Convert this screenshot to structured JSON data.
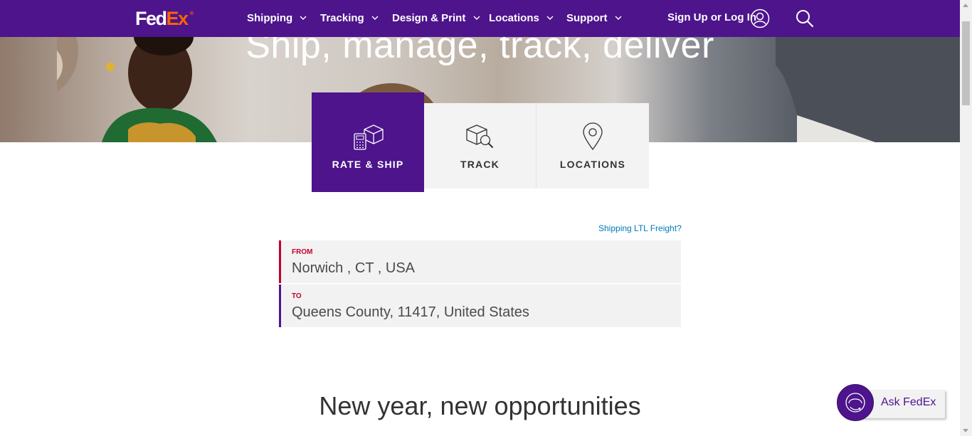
{
  "header": {
    "logo_fed": "Fed",
    "logo_ex": "Ex",
    "logo_mark": "®",
    "nav": [
      {
        "label": "Shipping"
      },
      {
        "label": "Tracking"
      },
      {
        "label": "Design & Print"
      },
      {
        "label": "Locations"
      },
      {
        "label": "Support"
      }
    ],
    "login_label": "Sign Up or Log In"
  },
  "hero": {
    "title": "Ship, manage, track, deliver"
  },
  "tabs": [
    {
      "label": "RATE & SHIP",
      "icon": "package-calculator-icon",
      "active": true
    },
    {
      "label": "TRACK",
      "icon": "package-search-icon",
      "active": false
    },
    {
      "label": "LOCATIONS",
      "icon": "map-pin-icon",
      "active": false
    }
  ],
  "rate_form": {
    "ltl_link": "Shipping LTL Freight?",
    "from_label": "FROM",
    "from_value": "Norwich , CT , USA",
    "to_label": "TO",
    "to_value": "Queens County, 11417, United States"
  },
  "promo": {
    "heading": "New year, new opportunities"
  },
  "chat": {
    "label": "Ask FedEx"
  },
  "colors": {
    "brand_purple": "#4d148c",
    "brand_orange": "#ff6200",
    "from_accent": "#c2002f",
    "to_accent": "#4d148c",
    "link": "#007ab7"
  }
}
